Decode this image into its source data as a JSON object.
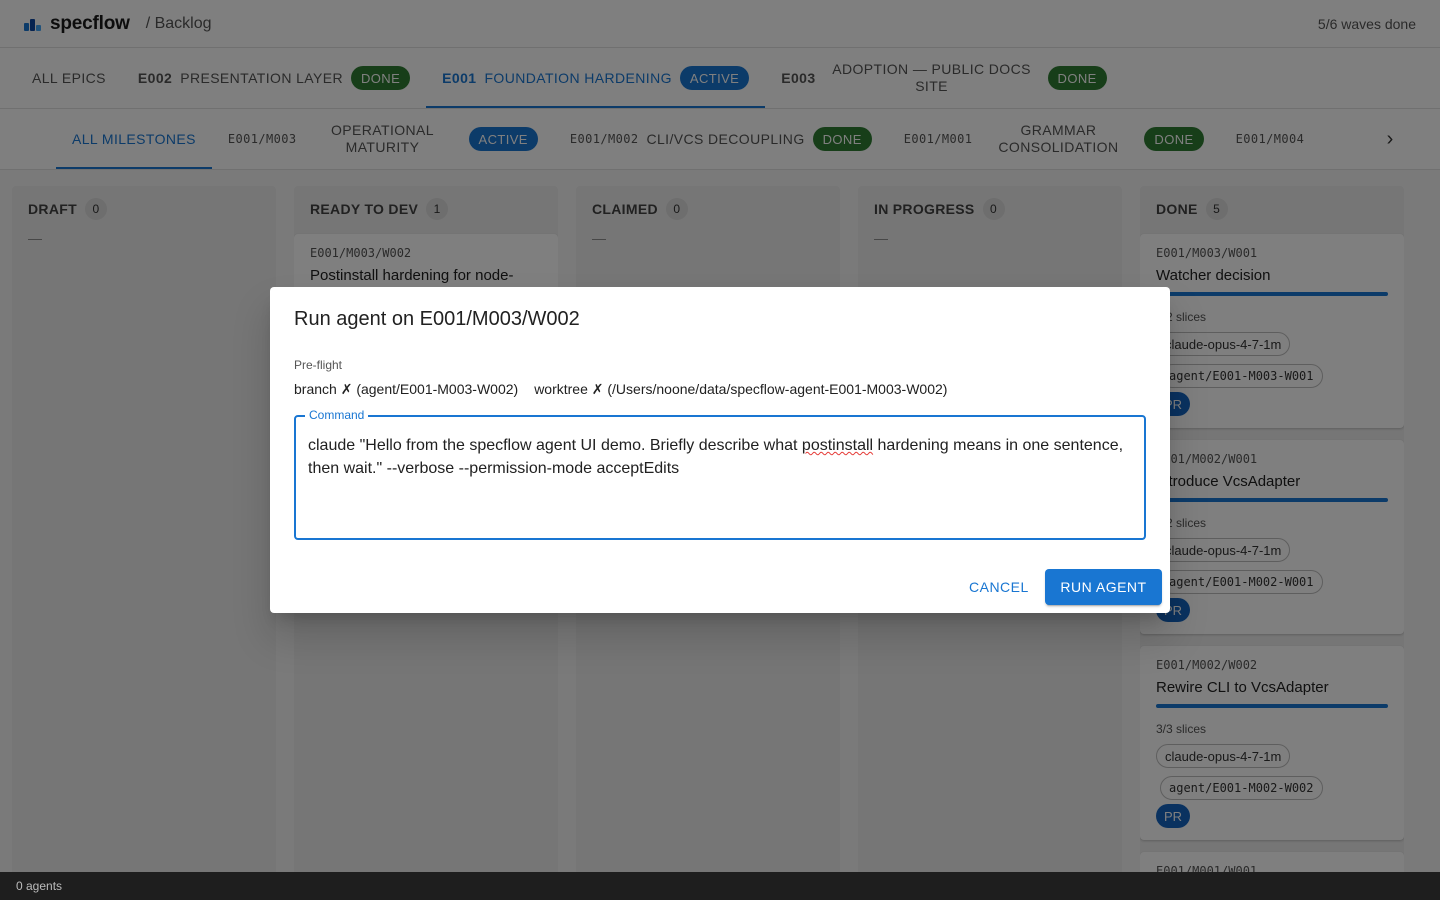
{
  "app": {
    "name": "specflow",
    "breadcrumb": "/ Backlog",
    "waves_status": "5/6 waves done"
  },
  "epic_tabs": [
    {
      "label": "ALL EPICS"
    },
    {
      "code": "E002",
      "title": "PRESENTATION LAYER",
      "status": "DONE"
    },
    {
      "code": "E001",
      "title": "FOUNDATION HARDENING",
      "status": "ACTIVE"
    },
    {
      "code": "E003",
      "title": "ADOPTION — PUBLIC DOCS SITE",
      "status": "DONE"
    }
  ],
  "milestone_tabs": [
    {
      "label": "ALL MILESTONES"
    },
    {
      "code": "E001/M003",
      "title": "OPERATIONAL MATURITY",
      "status": "ACTIVE"
    },
    {
      "code": "E001/M002",
      "title": "CLI/VCS DECOUPLING",
      "status": "DONE"
    },
    {
      "code": "E001/M001",
      "title": "GRAMMAR CONSOLIDATION",
      "status": "DONE"
    },
    {
      "code": "E001/M004",
      "title": ""
    }
  ],
  "columns": [
    {
      "title": "DRAFT",
      "count": "0",
      "empty": "—"
    },
    {
      "title": "READY TO DEV",
      "count": "1",
      "card": {
        "id": "E001/M003/W002",
        "title": "Postinstall hardening for node-"
      }
    },
    {
      "title": "CLAIMED",
      "count": "0",
      "empty": "—"
    },
    {
      "title": "IN PROGRESS",
      "count": "0",
      "empty": "—"
    },
    {
      "title": "DONE",
      "count": "5"
    }
  ],
  "done_cards": [
    {
      "id": "E001/M003/W001",
      "title": "Watcher decision",
      "slices": "2/2 slices",
      "model": "claude-opus-4-7-1m",
      "branch": "agent/E001-M003-W001",
      "pr": "PR",
      "progress": 1.0
    },
    {
      "id": "E001/M002/W001",
      "title": "Introduce VcsAdapter",
      "slices": "2/2 slices",
      "model": "claude-opus-4-7-1m",
      "branch": "agent/E001-M002-W001",
      "pr": "PR",
      "progress": 1.0
    },
    {
      "id": "E001/M002/W002",
      "title": "Rewire CLI to VcsAdapter",
      "slices": "3/3 slices",
      "model": "claude-opus-4-7-1m",
      "branch": "agent/E001-M002-W002",
      "pr": "PR",
      "progress": 1.0
    },
    {
      "id": "E001/M001/W001"
    }
  ],
  "statusbar": {
    "text": "0 agents"
  },
  "dialog": {
    "title": "Run agent on E001/M003/W002",
    "preflight_label": "Pre-flight",
    "branch_check": "branch ✗ (agent/E001-M003-W002)",
    "worktree_check": "worktree ✗ (/Users/noone/data/specflow-agent-E001-M003-W002)",
    "command_label": "Command",
    "command_before": "claude \"Hello from the specflow agent UI demo. Briefly describe what ",
    "command_misspelled": "postinstall",
    "command_after": " hardening means in one sentence, then wait.\" --verbose --permission-mode acceptEdits",
    "cancel_label": "CANCEL",
    "run_label": "RUN AGENT"
  },
  "colors": {
    "primary": "#1976d2",
    "done": "#2e7d32",
    "pr": "#1565c0"
  }
}
